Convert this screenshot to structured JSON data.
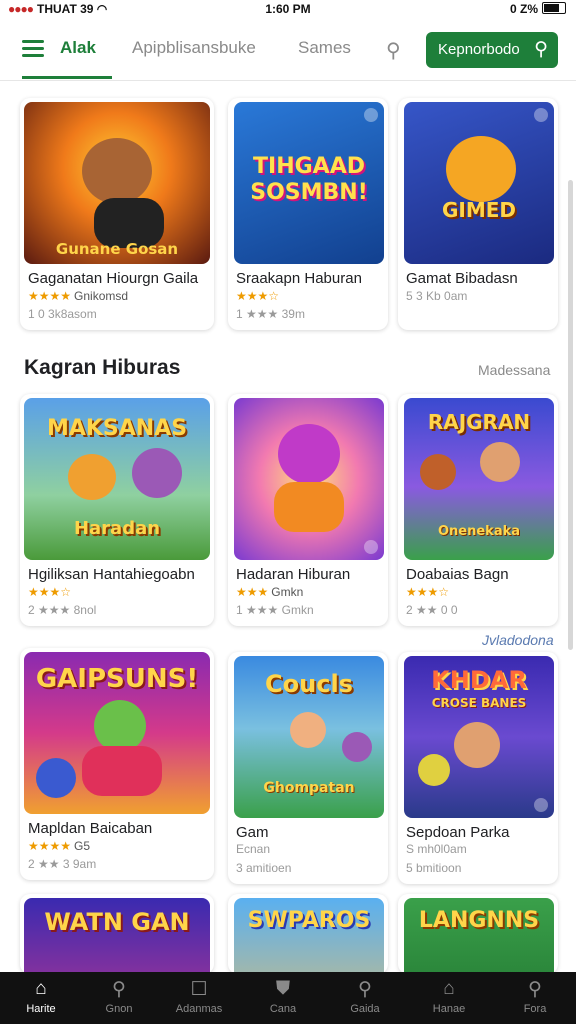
{
  "status_bar": {
    "carrier": "ΤΗUAT 39",
    "time": "1:60 PM",
    "battery": "0 Z%"
  },
  "header": {
    "tabs": [
      {
        "label": "Alak"
      },
      {
        "label": "Apipblisansbuke"
      },
      {
        "label": "Sames"
      }
    ],
    "search_button_label": "Kepnorbodo"
  },
  "sections": [
    {
      "title": "",
      "link": ""
    },
    {
      "title": "Kagran Hiburas",
      "link": "Madessana"
    },
    {
      "title": "",
      "link": "Jvladodona"
    }
  ],
  "cards": [
    {
      "art_text": "Gunane Gosan",
      "name": "Gaganatan Hiourgn Gaila",
      "rating": "★★★★",
      "rating_count": "Gnikomsd",
      "meta": "1 0 3k8asom"
    },
    {
      "art_text": "TIHGAAD SOSMBN!",
      "name": "Sraakapn Haburan",
      "rating": "★★★☆",
      "rating_count": "",
      "meta": "1 ★★★ 39m"
    },
    {
      "art_text": "GIMED",
      "name": "Gamat Bibadasn",
      "rating": "",
      "rating_count": "",
      "meta": "5 3 Kb 0am"
    },
    {
      "art_text": "MAKSANAS",
      "art_sub": "Haradan",
      "name": "Hgiliksan Hantahiegoabn",
      "rating": "★★★☆",
      "rating_count": "",
      "meta": "2 ★★★ 8nol"
    },
    {
      "art_text": "",
      "name": "Hadaran Hiburan",
      "rating": "★★★",
      "rating_count": "Gmkn",
      "meta": "1 ★★★ Gmkn"
    },
    {
      "art_text": "RAJGRAN",
      "art_sub": "Onenekaka",
      "name": "Doabaias Bagn",
      "rating": "★★★☆",
      "rating_count": "",
      "meta": "2 ★★ 0 0"
    },
    {
      "art_text": "GAIPSUNS!",
      "name": "Mapldan Baicaban",
      "rating": "★★★★",
      "rating_count": "G5",
      "meta": "2 ★★ 3 9am"
    },
    {
      "art_text": "Coucls",
      "art_sub": "Ghompatan",
      "name": "Gam",
      "rating": "",
      "rating_count": "",
      "meta": "3 amitioen"
    },
    {
      "art_text": "KHDAR",
      "art_sub": "CROSE BANES",
      "name": "Sepdoan Parka",
      "rating": "",
      "rating_count": "",
      "meta": "5 bmitioon"
    },
    {
      "art_text": "WATN GAN",
      "name": "",
      "rating": "",
      "rating_count": "",
      "meta": ""
    },
    {
      "art_text": "SWPAROS",
      "name": "",
      "rating": "",
      "rating_count": "",
      "meta": ""
    },
    {
      "art_text": "LANGNNS",
      "name": "",
      "rating": "",
      "rating_count": "",
      "meta": ""
    }
  ],
  "bottom_nav": [
    {
      "label": "Harite",
      "icon": "home-icon"
    },
    {
      "label": "Gnon",
      "icon": "search-icon"
    },
    {
      "label": "Adanmas",
      "icon": "square-icon"
    },
    {
      "label": "Cana",
      "icon": "shield-icon"
    },
    {
      "label": "Gaida",
      "icon": "search-icon"
    },
    {
      "label": "Hanae",
      "icon": "house-outline-icon"
    },
    {
      "label": "Fora",
      "icon": "search-icon"
    }
  ],
  "colors": {
    "accent": "#1e7f3a",
    "nav_bg": "#111111",
    "star": "#ee9b00"
  }
}
